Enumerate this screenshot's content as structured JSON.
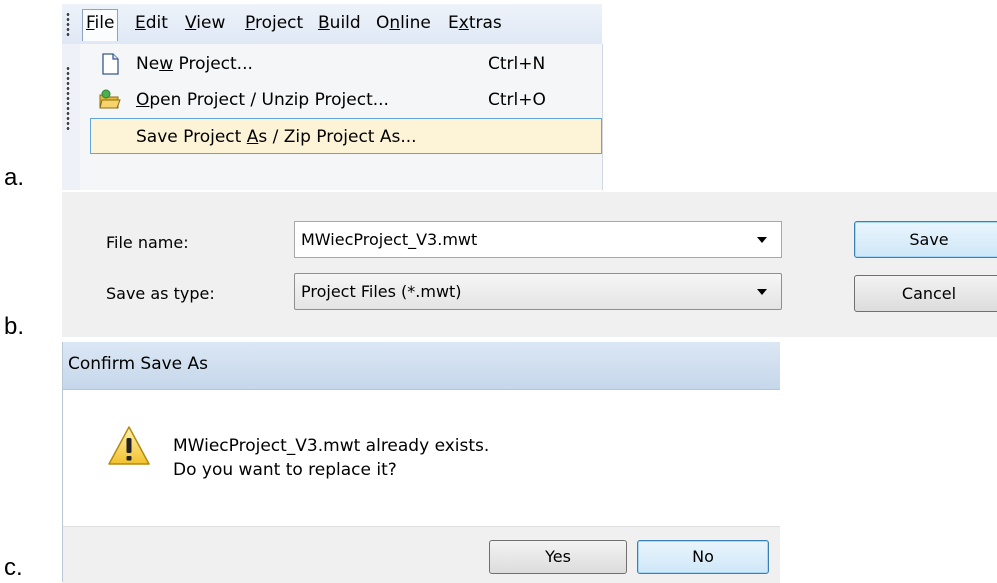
{
  "labels": {
    "a": "a.",
    "b": "b.",
    "c": "c."
  },
  "menubar": {
    "items": [
      {
        "label": "File",
        "underline": "F",
        "rest": "ile"
      },
      {
        "label": "Edit",
        "underline": "E",
        "rest": "dit"
      },
      {
        "label": "View",
        "underline": "V",
        "rest": "iew"
      },
      {
        "label": "Project",
        "underline": "P",
        "rest": "roject"
      },
      {
        "label": "Build",
        "underline": "B",
        "rest": "uild"
      },
      {
        "label": "Online",
        "pre": "O",
        "underline": "n",
        "rest": "line"
      },
      {
        "label": "Extras",
        "pre": "E",
        "underline": "x",
        "rest": "tras"
      }
    ]
  },
  "file_menu": {
    "new_project": {
      "pre": "Ne",
      "underline": "w",
      "rest": " Project...",
      "shortcut": "Ctrl+N",
      "icon": "new-document-icon"
    },
    "open_project": {
      "underline": "O",
      "rest": "pen Project / Unzip Project...",
      "shortcut": "Ctrl+O",
      "icon": "open-folder-icon"
    },
    "save_project_as": {
      "pre": "Save Project ",
      "underline": "A",
      "rest": "s / Zip Project As..."
    }
  },
  "save_dialog": {
    "file_name_label": "File name:",
    "file_name_value": "MWiecProject_V3.mwt",
    "save_type_label": "Save as type:",
    "save_type_value": "Project Files (*.mwt)",
    "save_button": "Save",
    "cancel_button": "Cancel"
  },
  "confirm_dialog": {
    "title": "Confirm Save As",
    "message_line1": "MWiecProject_V3.mwt already exists.",
    "message_line2": "Do you want to replace it?",
    "yes_button": "Yes",
    "no_button": "No",
    "icon": "warning-icon"
  },
  "colors": {
    "highlight_bg": "#fdf4d8",
    "highlight_border": "#63a6dc",
    "title_bar": "#c6d7eb"
  }
}
